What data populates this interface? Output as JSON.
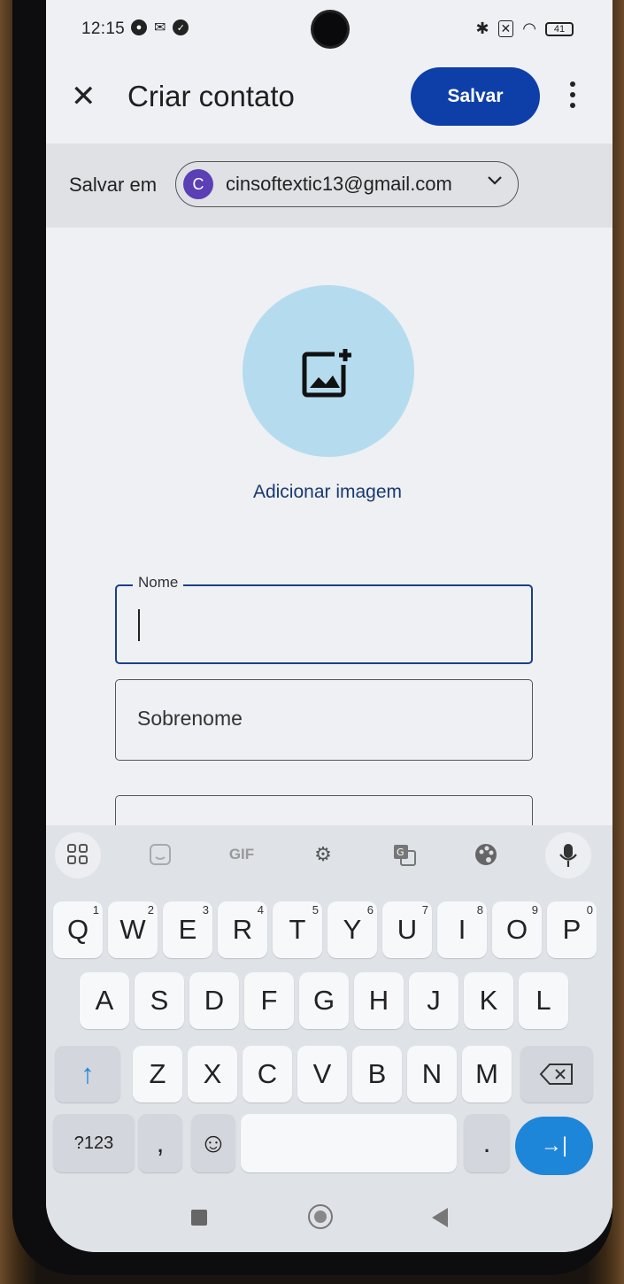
{
  "status_bar": {
    "time": "12:15",
    "battery": "41"
  },
  "app_bar": {
    "title": "Criar contato",
    "save_label": "Salvar"
  },
  "save_in": {
    "label": "Salvar em",
    "avatar_letter": "C",
    "account": "cinsoftextic13@gmail.com"
  },
  "photo": {
    "add_label": "Adicionar imagem"
  },
  "form": {
    "first_name_label": "Nome",
    "first_name_value": "",
    "last_name_placeholder": "Sobrenome"
  },
  "keyboard": {
    "toolbar": [
      "apps-icon",
      "sticker-icon",
      "GIF",
      "gear-icon",
      "translate-icon",
      "palette-icon",
      "mic-icon"
    ],
    "gif_label": "GIF",
    "row1": [
      {
        "k": "Q",
        "n": "1"
      },
      {
        "k": "W",
        "n": "2"
      },
      {
        "k": "E",
        "n": "3"
      },
      {
        "k": "R",
        "n": "4"
      },
      {
        "k": "T",
        "n": "5"
      },
      {
        "k": "Y",
        "n": "6"
      },
      {
        "k": "U",
        "n": "7"
      },
      {
        "k": "I",
        "n": "8"
      },
      {
        "k": "O",
        "n": "9"
      },
      {
        "k": "P",
        "n": "0"
      }
    ],
    "row2": [
      "A",
      "S",
      "D",
      "F",
      "G",
      "H",
      "J",
      "K",
      "L"
    ],
    "row3": [
      "Z",
      "X",
      "C",
      "V",
      "B",
      "N",
      "M"
    ],
    "symbols_label": "?123",
    "comma": ",",
    "period": ".",
    "enter_symbol": "→|",
    "shift_symbol": "↑",
    "emoji_symbol": "☺"
  },
  "colors": {
    "accent": "#0e3fa8",
    "avatar": "#5b3fb5",
    "photo_bg": "#b5dcee",
    "enter": "#1e86d9"
  }
}
